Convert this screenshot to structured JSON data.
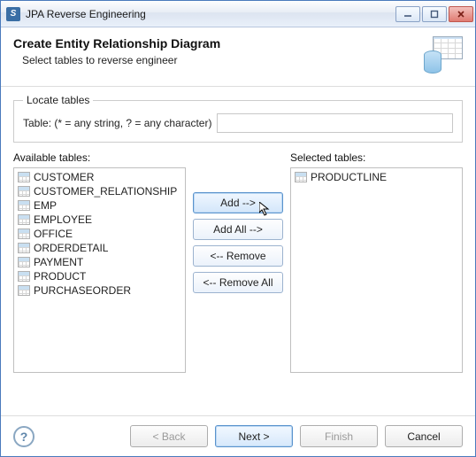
{
  "window": {
    "title": "JPA Reverse Engineering"
  },
  "banner": {
    "heading": "Create Entity Relationship Diagram",
    "sub": "Select tables to reverse engineer"
  },
  "locate": {
    "legend": "Locate tables",
    "filter_label": "Table: (* = any string, ? = any character)",
    "filter_value": ""
  },
  "available": {
    "label": "Available tables:",
    "items": [
      "CUSTOMER",
      "CUSTOMER_RELATIONSHIP",
      "EMP",
      "EMPLOYEE",
      "OFFICE",
      "ORDERDETAIL",
      "PAYMENT",
      "PRODUCT",
      "PURCHASEORDER"
    ]
  },
  "selected": {
    "label": "Selected tables:",
    "items": [
      "PRODUCTLINE"
    ]
  },
  "transfer": {
    "add": "Add -->",
    "add_all": "Add All -->",
    "remove": "<-- Remove",
    "remove_all": "<-- Remove All"
  },
  "nav": {
    "back": "< Back",
    "next": "Next >",
    "finish": "Finish",
    "cancel": "Cancel"
  }
}
